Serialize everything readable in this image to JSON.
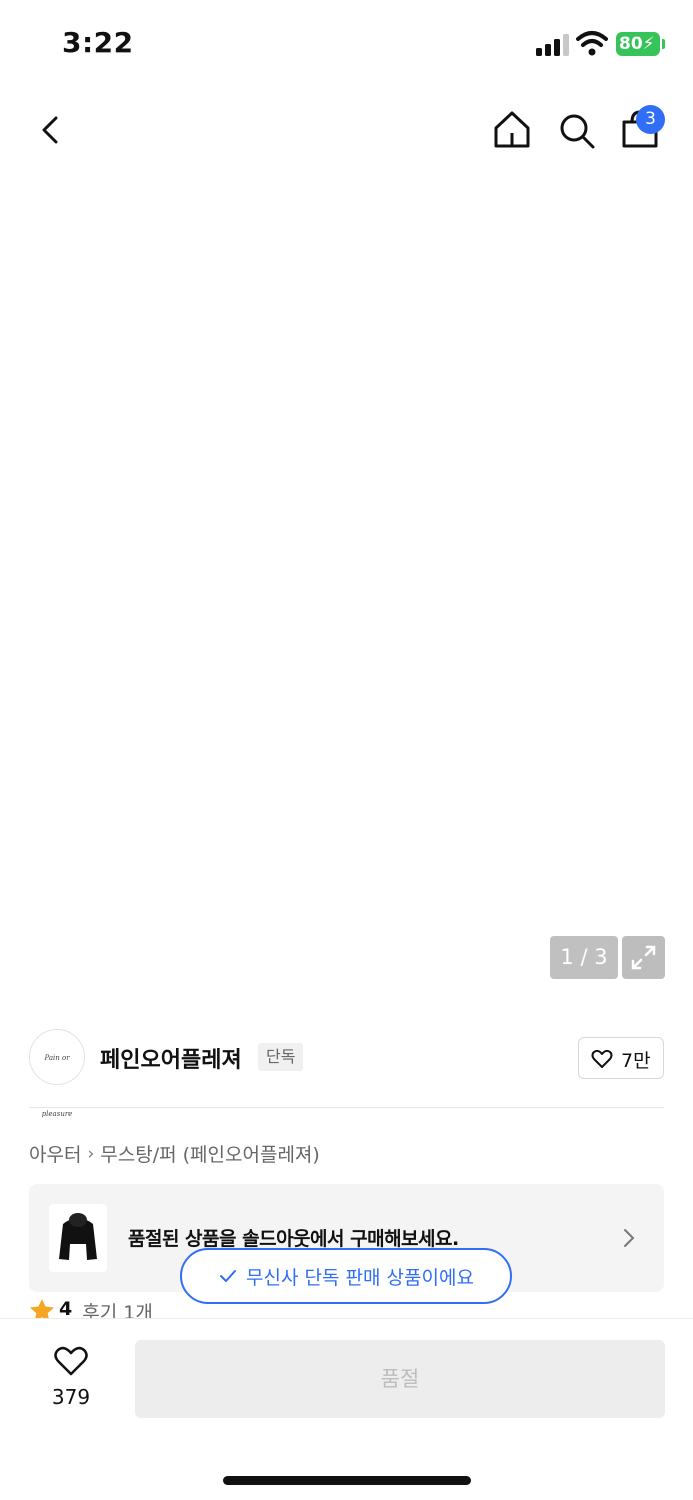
{
  "status_bar": {
    "time": "3:22",
    "battery": "80"
  },
  "header": {
    "back_icon": "chevron-left-icon",
    "home_icon": "home-icon",
    "search_icon": "search-icon",
    "cart_icon": "shopping-bag-icon",
    "cart_count": "3",
    "badge_color": "#2f6ef5"
  },
  "gallery": {
    "counter": "1 / 3",
    "expand_icon": "expand-icon"
  },
  "brand": {
    "logo_text": "Pain or pleasure",
    "name": "페인오어플레져",
    "exclusive_tag": "단독",
    "like_count": "7만"
  },
  "breadcrumb": {
    "category": "아우터",
    "subcategory": "무스탕/퍼 (페인오어플레져)"
  },
  "soldout_banner": {
    "text": "품절된 상품을 솔드아웃에서 구매해보세요."
  },
  "rating": {
    "score": "4",
    "reviews": "후기 1개"
  },
  "toast": {
    "text": "무신사 단독 판매 상품이에요",
    "accent": "#2f6ef5"
  },
  "bottom_bar": {
    "wish_count": "379",
    "soldout_label": "품절"
  }
}
